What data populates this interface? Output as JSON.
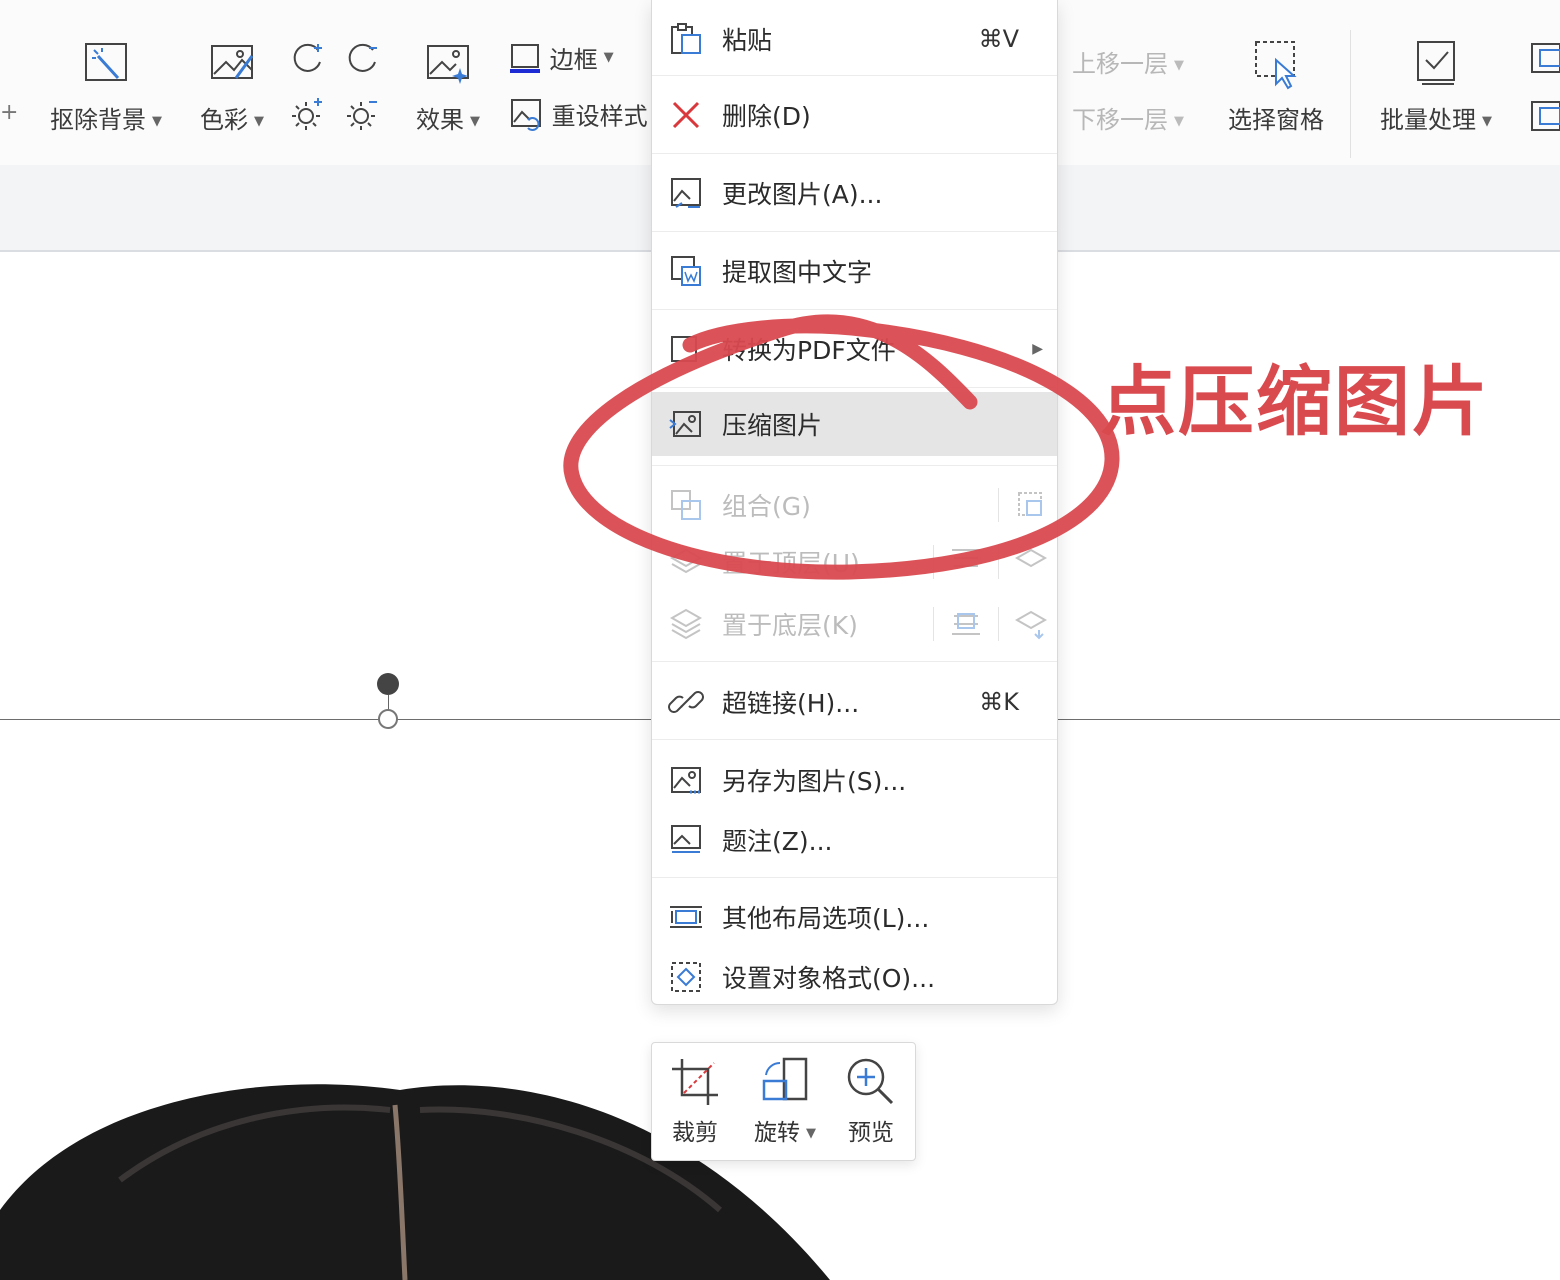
{
  "ribbon": {
    "remove_bg": "抠除背景",
    "color": "色彩",
    "effect": "效果",
    "border": "边框",
    "reset_style": "重设样式",
    "move_up": "上移一层",
    "move_down": "下移一层",
    "selection_pane": "选择窗格",
    "batch": "批量处理"
  },
  "menu": {
    "paste": {
      "label": "粘贴",
      "shortcut": "⌘V"
    },
    "delete": {
      "label": "删除(D)"
    },
    "change_picture": {
      "label": "更改图片(A)..."
    },
    "extract_text": {
      "label": "提取图中文字"
    },
    "convert": {
      "label": "转换为PDF文件"
    },
    "compress": {
      "label": "压缩图片"
    },
    "group": {
      "label": "组合(G)"
    },
    "bring_front": {
      "label": "置于顶层(U)"
    },
    "send_back": {
      "label": "置于底层(K)"
    },
    "hyperlink": {
      "label": "超链接(H)...",
      "shortcut": "⌘K"
    },
    "save_as": {
      "label": "另存为图片(S)..."
    },
    "caption": {
      "label": "题注(Z)..."
    },
    "layout": {
      "label": "其他布局选项(L)..."
    },
    "format": {
      "label": "设置对象格式(O)..."
    }
  },
  "minibar": {
    "crop": "裁剪",
    "rotate": "旋转",
    "preview": "预览"
  },
  "annotation": {
    "text": "点压缩图片",
    "color": "#d94a4f"
  }
}
